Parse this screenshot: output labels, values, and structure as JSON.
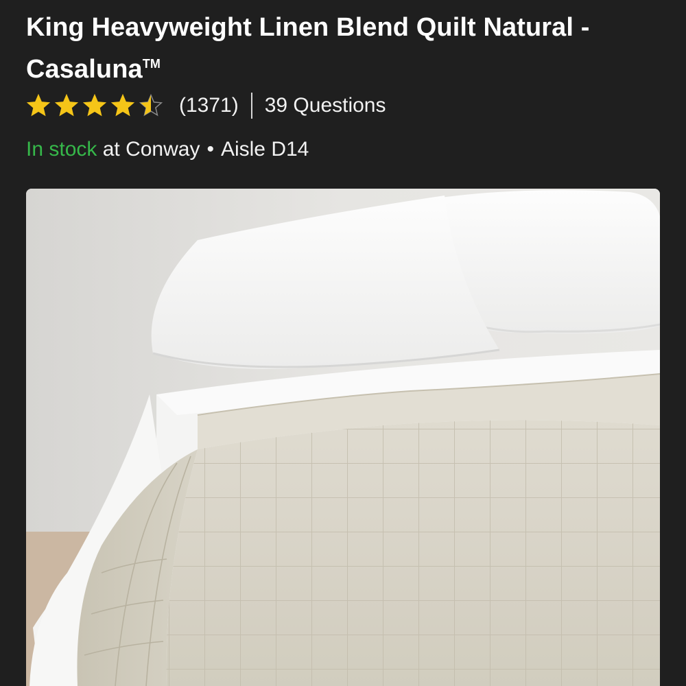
{
  "product": {
    "title": "King Heavyweight Linen Blend Quilt Natural - Casaluna",
    "trademark": "TM",
    "rating": {
      "stars": 4.5,
      "max": 5,
      "review_count_text": "(1371)",
      "questions_text": "39 Questions"
    },
    "availability": {
      "status": "In stock",
      "location_text": " at Conway",
      "bullet": "•",
      "aisle": "Aisle D14"
    },
    "image": {
      "alt": "King Heavyweight Linen Blend Quilt Natural",
      "quilt_color": "#d9d5c8",
      "sheet_color": "#f7f7f6",
      "wall_color": "#e1e0dd"
    }
  },
  "colors": {
    "background": "#1f1f1f",
    "star": "#f5c518",
    "in_stock": "#36b84a",
    "text": "#ffffff"
  },
  "icons": {
    "star_full": "star-icon",
    "star_half": "star-half-icon"
  }
}
